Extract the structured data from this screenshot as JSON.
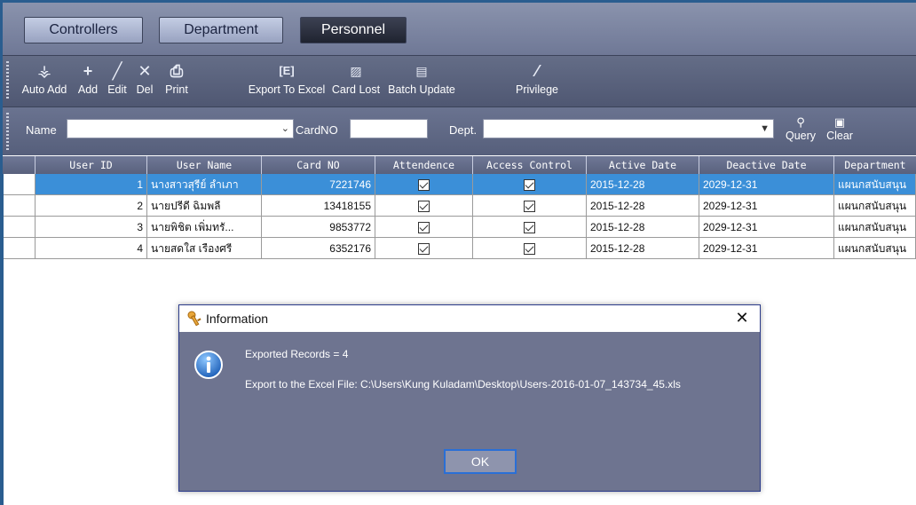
{
  "tabs": [
    {
      "label": "Controllers"
    },
    {
      "label": "Department"
    },
    {
      "label": "Personnel"
    }
  ],
  "toolbar": {
    "items": [
      {
        "label": "Auto Add",
        "icon": "auto-add-icon"
      },
      {
        "label": "Add",
        "icon": "plus-icon"
      },
      {
        "label": "Edit",
        "icon": "pencil-icon"
      },
      {
        "label": "Del",
        "icon": "x-icon"
      },
      {
        "label": "Print",
        "icon": "printer-icon"
      },
      {
        "label": "Export To Excel",
        "icon": "excel-icon"
      },
      {
        "label": "Card Lost",
        "icon": "card-lost-icon"
      },
      {
        "label": "Batch Update",
        "icon": "batch-update-icon"
      },
      {
        "label": "Privilege",
        "icon": "privilege-icon"
      }
    ]
  },
  "filter": {
    "name_label": "Name",
    "name_value": "",
    "cardno_label": "CardNO",
    "cardno_value": "",
    "dept_label": "Dept.",
    "dept_value": "",
    "query_label": "Query",
    "clear_label": "Clear"
  },
  "table": {
    "headers": [
      "User ID",
      "User Name",
      "Card NO",
      "Attendence",
      "Access Control",
      "Active Date",
      "Deactive Date",
      "Department"
    ],
    "rows": [
      {
        "id": "1",
        "name": "นางสาวสุรีย์ ลำเภา",
        "card": "7221746",
        "attendance": true,
        "access": true,
        "active": "2015-12-28",
        "deactive": "2029-12-31",
        "dept": "แผนกสนับสนุน",
        "selected": true
      },
      {
        "id": "2",
        "name": "นายปรีดี ฉิมพลี",
        "card": "13418155",
        "attendance": true,
        "access": true,
        "active": "2015-12-28",
        "deactive": "2029-12-31",
        "dept": "แผนกสนับสนุน",
        "selected": false
      },
      {
        "id": "3",
        "name": "นายพิชิต เพิ่มทรั...",
        "card": "9853772",
        "attendance": true,
        "access": true,
        "active": "2015-12-28",
        "deactive": "2029-12-31",
        "dept": "แผนกสนับสนุน",
        "selected": false
      },
      {
        "id": "4",
        "name": "นายสดใส เรืองศรี",
        "card": "6352176",
        "attendance": true,
        "access": true,
        "active": "2015-12-28",
        "deactive": "2029-12-31",
        "dept": "แผนกสนับสนุน",
        "selected": false
      }
    ]
  },
  "dialog": {
    "title": "Information",
    "line1": "Exported Records = 4",
    "line2": "Export to the Excel File: C:\\Users\\Kung Kuladam\\Desktop\\Users-2016-01-07_143734_45.xls",
    "ok_label": "OK",
    "close_label": "✕"
  }
}
